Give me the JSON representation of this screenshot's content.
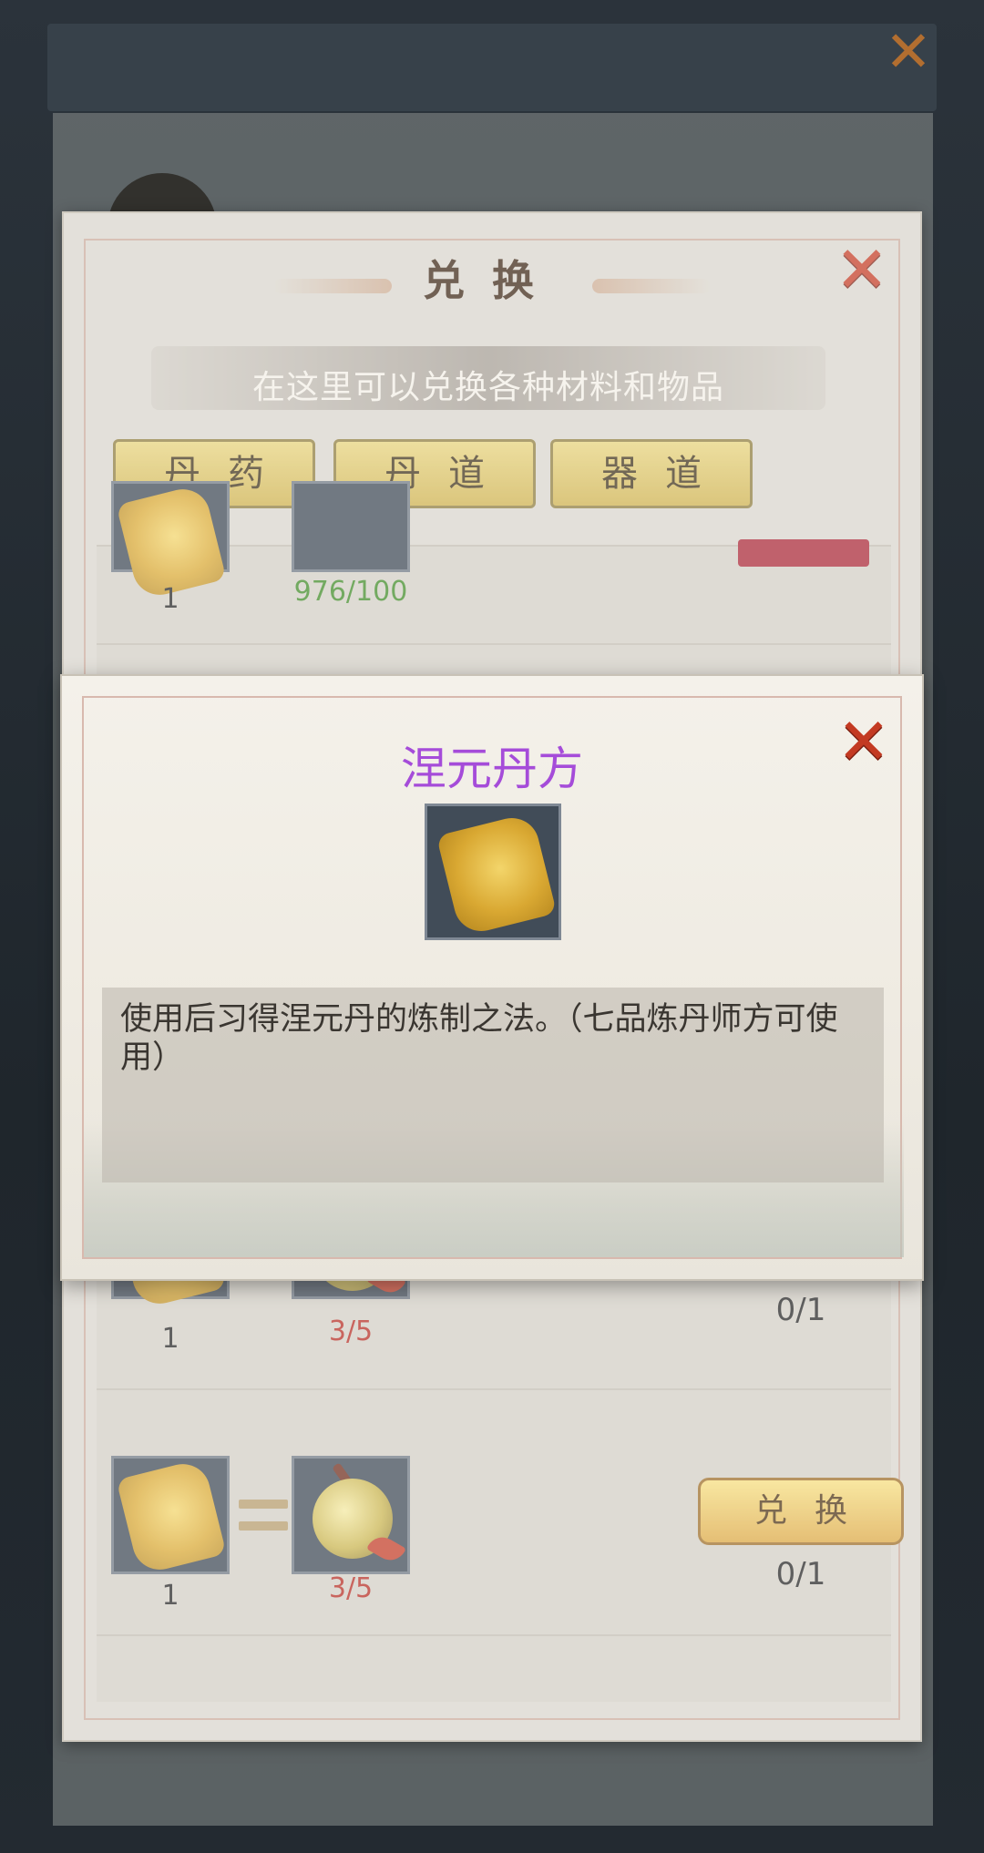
{
  "dialog": {
    "title": "兑换",
    "subtitle": "在这里可以兑换各种材料和物品",
    "tabs": [
      {
        "label": "丹药"
      },
      {
        "label": "丹道"
      },
      {
        "label": "器道"
      }
    ]
  },
  "rows": [
    {
      "give_qty": "1",
      "cost": "976/100",
      "cost_status": "enough"
    },
    {
      "give_qty": "1",
      "cost": "3/5",
      "progress": "0/1",
      "cost_status": "insufficient"
    },
    {
      "give_qty": "1",
      "cost": "3/5",
      "button": "兑换",
      "progress": "0/1",
      "cost_status": "insufficient"
    }
  ],
  "popup": {
    "title": "涅元丹方",
    "description": "使用后习得涅元丹的炼制之法。（七品炼丹师方可使用）",
    "icon": "recipe-scroll-icon"
  },
  "colors": {
    "popup_title": "#a54cd9",
    "cost_enough": "#3e8a25",
    "cost_insufficient": "#b42a20",
    "close": "#c33a22"
  }
}
